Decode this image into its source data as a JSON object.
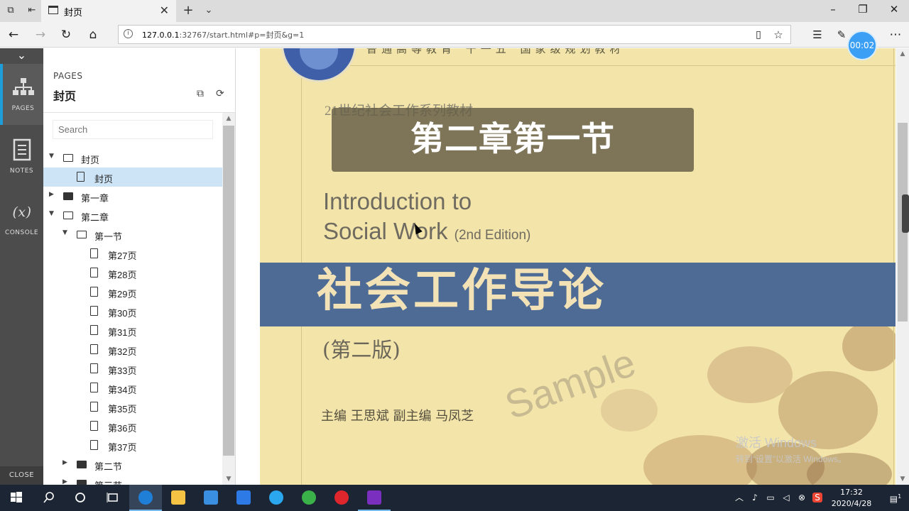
{
  "browser": {
    "tab_title": "封页",
    "url_host": "127.0.0.1",
    "url_rest": ":32767/start.html#p=封页&g=1",
    "timer": "00:02"
  },
  "rail": {
    "items": [
      {
        "label": "PAGES",
        "icon": "sitemap-icon"
      },
      {
        "label": "NOTES",
        "icon": "notes-icon"
      },
      {
        "label": "CONSOLE",
        "icon": "console-icon"
      }
    ],
    "close_label": "CLOSE"
  },
  "panel": {
    "kicker": "PAGES",
    "title": "封页",
    "search_placeholder": "Search",
    "tree": [
      {
        "label": "封页",
        "type": "folder-open",
        "level": 0,
        "expanded": true
      },
      {
        "label": "封页",
        "type": "page",
        "level": 1,
        "selected": true
      },
      {
        "label": "第一章",
        "type": "folder",
        "level": 0,
        "expanded": false
      },
      {
        "label": "第二章",
        "type": "folder-open",
        "level": 0,
        "expanded": true
      },
      {
        "label": "第一节",
        "type": "folder-open",
        "level": 1,
        "expanded": true
      },
      {
        "label": "第27页",
        "type": "page",
        "level": 2
      },
      {
        "label": "第28页",
        "type": "page",
        "level": 2
      },
      {
        "label": "第29页",
        "type": "page",
        "level": 2
      },
      {
        "label": "第30页",
        "type": "page",
        "level": 2
      },
      {
        "label": "第31页",
        "type": "page",
        "level": 2
      },
      {
        "label": "第32页",
        "type": "page",
        "level": 2
      },
      {
        "label": "第33页",
        "type": "page",
        "level": 2
      },
      {
        "label": "第34页",
        "type": "page",
        "level": 2
      },
      {
        "label": "第35页",
        "type": "page",
        "level": 2
      },
      {
        "label": "第36页",
        "type": "page",
        "level": 2
      },
      {
        "label": "第37页",
        "type": "page",
        "level": 2
      },
      {
        "label": "第二节",
        "type": "folder",
        "level": 1,
        "expanded": false
      },
      {
        "label": "第三节",
        "type": "folder",
        "level": 1,
        "expanded": false
      }
    ]
  },
  "cover": {
    "top_line": "普通高等教育“十一五”国家级规划教材",
    "series": "21世纪社会工作系列教材",
    "en_title_1": "Introduction to",
    "en_title_2": "Social Work",
    "en_edition": "(2nd Edition)",
    "cn_title": "社会工作导论",
    "cn_edition": "(第二版)",
    "authors": "主编  王思斌    副主编  马凤芝",
    "watermark": "Sample"
  },
  "caption": "第二章第一节",
  "activation": {
    "line1": "激活 Windows",
    "line2": "转到“设置”以激活 Windows。"
  },
  "taskbar": {
    "time": "17:32",
    "date": "2020/4/28",
    "notification_count": "1"
  },
  "colors": {
    "accent": "#1d9dd9",
    "selection": "#cde4f7",
    "cover_band": "#4d6b95",
    "cover_bg": "#f3e4a9"
  }
}
